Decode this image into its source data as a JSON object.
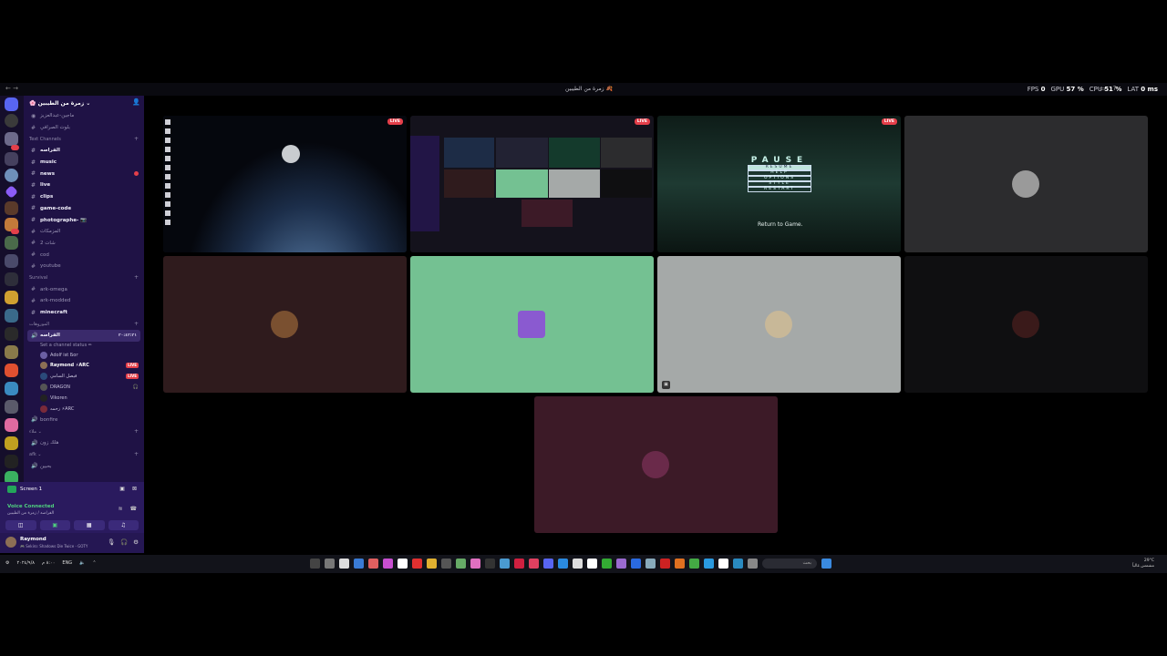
{
  "titlebar": {
    "window_title": "زمرة من الطيبين 🍂",
    "stats": [
      {
        "label": "FPS",
        "value": "0"
      },
      {
        "label": "GPU",
        "value": "57 %"
      },
      {
        "label": "CPU",
        "value": "51 %"
      },
      {
        "label": "LAT",
        "value": "0 ms"
      }
    ]
  },
  "server": {
    "name": "🌸 زمرة من الطيبين ⌄",
    "top_items": [
      "ماجين-عبدالعزيز",
      "بلوت الصرافي"
    ],
    "categories": {
      "text_channels": "Text Channels",
      "survival": "Survival",
      "voice": "الموروهات",
      "cat3": "ملاء ⌄",
      "afk": "afk ⌄"
    },
    "text_channels": [
      {
        "name": "الفراصه",
        "bold": true
      },
      {
        "name": "music",
        "bold": true
      },
      {
        "name": "news",
        "bold": true,
        "unread": true
      },
      {
        "name": "live",
        "bold": true
      },
      {
        "name": "clips",
        "bold": true
      },
      {
        "name": "game-code",
        "bold": true
      },
      {
        "name": "photographe- 📷",
        "bold": true
      },
      {
        "name": "المزمكات",
        "bold": false
      },
      {
        "name": "شات 2",
        "bold": false
      },
      {
        "name": "cod",
        "bold": false
      },
      {
        "name": "youtube",
        "bold": false
      }
    ],
    "survival_channels": [
      {
        "name": "ark-omega",
        "bold": false
      },
      {
        "name": "ark-modded",
        "bold": false
      },
      {
        "name": "minecraft",
        "bold": true
      }
    ],
    "voice_channel": {
      "name": "الفراصه",
      "timer": "٢٠:٤٢:٢١",
      "status": "Set a channel status ✏",
      "users": [
        {
          "name": "Adolf ist Бог",
          "live": false
        },
        {
          "name": "Raymond ⚡ARC",
          "live": true
        },
        {
          "name": "فيصل السامي",
          "live": true
        },
        {
          "name": "DRAGON",
          "live": false
        },
        {
          "name": "Vikoren",
          "live": false
        },
        {
          "name": "زحمه ⚡ARC",
          "live": false
        }
      ]
    },
    "other_voice": [
      "bonfire",
      "هلك زون",
      "بحبين"
    ],
    "live_label": "LIVE"
  },
  "voice_panel": {
    "screen_label": "Screen 1",
    "connected": "Voice Connected",
    "channel_path": "الفراصه / زمرة من الطيبين"
  },
  "user": {
    "name": "Raymond",
    "activity": "🎮 Sekiro: Shadows Die Twice - GOTY"
  },
  "streams": {
    "live_label": "LIVE",
    "pause_title": "PAUSE",
    "pause_items": [
      "RESUME",
      "HELP",
      "OPTIONS",
      "STYLE",
      "RESTART"
    ],
    "return_text": "Return to Game."
  },
  "taskbar": {
    "weather": "29°C",
    "weather_desc": "مشمس غالباً",
    "time": "٨:٠٠ م",
    "date": "٢٠٢٤/٩/٨",
    "lang": "ENG",
    "search_placeholder": "بحث"
  },
  "colors": {
    "sidebar": "#1f1245",
    "rail": "#150e2b",
    "live": "#e43f4a",
    "connected": "#4fd07f",
    "tile_brown": "#2f1b1d",
    "tile_green": "#74c192",
    "tile_gray": "#a5a9a8",
    "tile_dark": "#0f0f11",
    "tile_maroon": "#3c1a27",
    "tile_grey2": "#2c2c2e"
  }
}
